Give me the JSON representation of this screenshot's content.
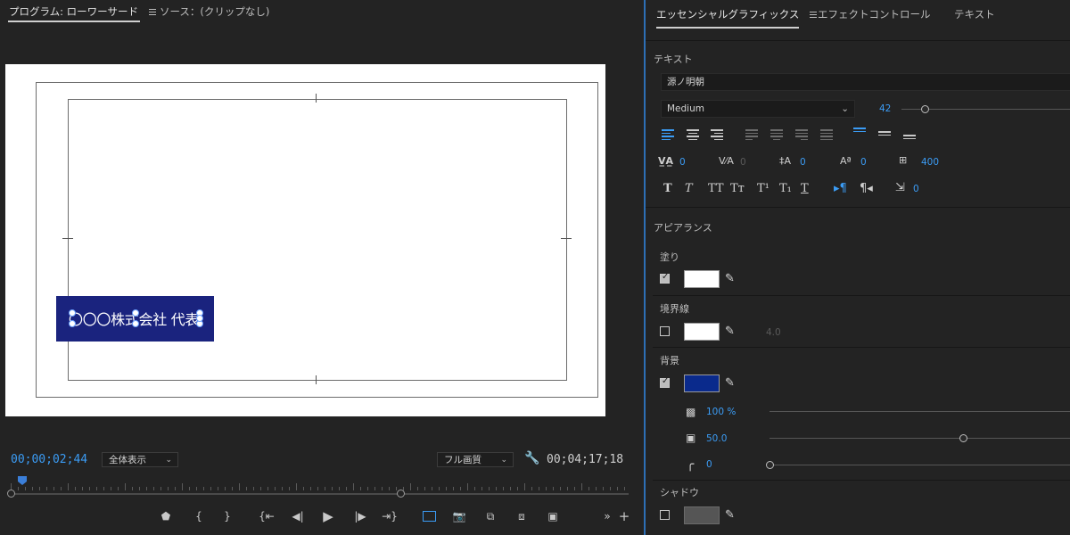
{
  "program": {
    "tab_label": "プログラム: ローワーサード",
    "source_tab_label": "ソース：(クリップなし)",
    "lower_third_text": "〇〇〇株式会社 代表",
    "timecode_current": "00;00;02;44",
    "zoom_option": "全体表示",
    "quality_option": "フル画質",
    "timecode_duration": "00;04;17;18",
    "transport_icons": [
      "marker-icon",
      "mark-in-icon",
      "mark-out-icon",
      "go-to-in-icon",
      "step-back-icon",
      "play-icon",
      "step-forward-icon",
      "go-to-out-icon",
      "safe-margins-icon",
      "export-frame-icon",
      "insert-icon",
      "overwrite-icon",
      "comparison-view-icon",
      "more-icon",
      "add-icon"
    ]
  },
  "essential_graphics": {
    "tabs": [
      {
        "label": "エッセンシャルグラフィックス"
      },
      {
        "label": "エフェクトコントロール"
      },
      {
        "label": "テキスト"
      }
    ],
    "text_section": {
      "label": "テキスト",
      "font": "源ノ明朝",
      "style": "Medium",
      "size": "42",
      "tracking_values": {
        "kerning": "0",
        "tracking": "0",
        "leading": "0",
        "baseline": "0",
        "tsume": "400",
        "indent": "0"
      }
    },
    "appearance": {
      "label": "アピアランス",
      "fill_label": "塗り",
      "fill_color": "#ffffff",
      "stroke_label": "境界線",
      "stroke_color": "#ffffff",
      "stroke_width": "4.0",
      "background_label": "背景",
      "background_color": "#0a2a8c",
      "opacity": "100 %",
      "size": "50.0",
      "corner": "0",
      "shadow_label": "シャドウ",
      "shadow_color": "#555555"
    },
    "accent_color": "#3b9cf5"
  }
}
